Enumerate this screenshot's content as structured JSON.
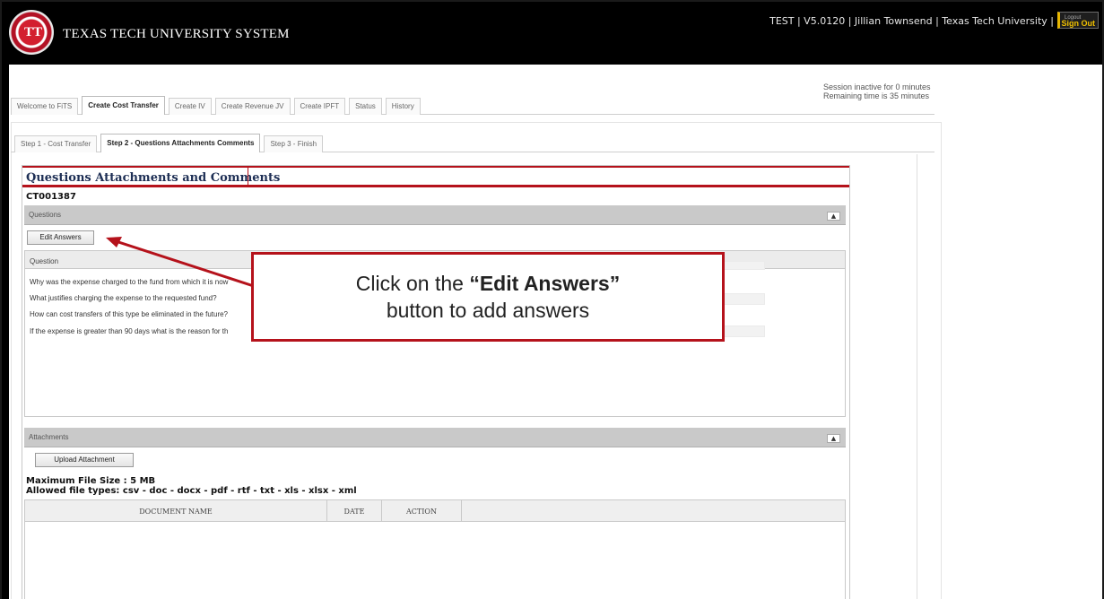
{
  "header": {
    "brand": "TEXAS TECH UNIVERSITY SYSTEM",
    "seal_letters": "TT",
    "user_info": "TEST | V5.0120 | Jillian Townsend | Texas Tech University |",
    "signout_label": "Sign Out",
    "signout_caption": "Logout"
  },
  "session": {
    "line1": "Session inactive for 0 minutes",
    "line2": "Remaining time is 35 minutes"
  },
  "main_tabs": [
    {
      "label": "Welcome to FiTS",
      "active": false
    },
    {
      "label": "Create Cost Transfer",
      "active": true
    },
    {
      "label": "Create IV",
      "active": false
    },
    {
      "label": "Create Revenue JV",
      "active": false
    },
    {
      "label": "Create IPFT",
      "active": false
    },
    {
      "label": "Status",
      "active": false
    },
    {
      "label": "History",
      "active": false
    }
  ],
  "sub_tabs": [
    {
      "label": "Step 1 - Cost Transfer",
      "active": false
    },
    {
      "label": "Step 2 - Questions Attachments Comments",
      "active": true
    },
    {
      "label": "Step 3 - Finish",
      "active": false
    }
  ],
  "panel": {
    "title": "Questions Attachments and Comments",
    "record_id": "CT001387"
  },
  "questions": {
    "section_label": "Questions",
    "collapse_symbol": "▲",
    "edit_button": "Edit Answers",
    "column_header": "Question",
    "rows": [
      "Why was the expense charged to the fund from which it is now",
      "What justifies charging the expense to the requested fund?",
      "How can cost transfers of this type be eliminated in the future?",
      "If the expense is greater than 90 days what is the reason for th"
    ]
  },
  "attachments": {
    "section_label": "Attachments",
    "collapse_symbol": "▲",
    "upload_button": "Upload Attachment",
    "max_size": "Maximum File Size : 5 MB",
    "allowed_types": "Allowed file types: csv - doc - docx - pdf - rtf - txt - xls - xlsx - xml",
    "columns": {
      "name": "DOCUMENT NAME",
      "date": "DATE",
      "action": "ACTION"
    }
  },
  "callout": {
    "line1_prefix": "Click on the ",
    "line1_bold": "“Edit Answers”",
    "line2": "button to add answers"
  },
  "colors": {
    "accent_red": "#b5121b",
    "header_black": "#000000",
    "section_gray": "#c9c9c9"
  }
}
